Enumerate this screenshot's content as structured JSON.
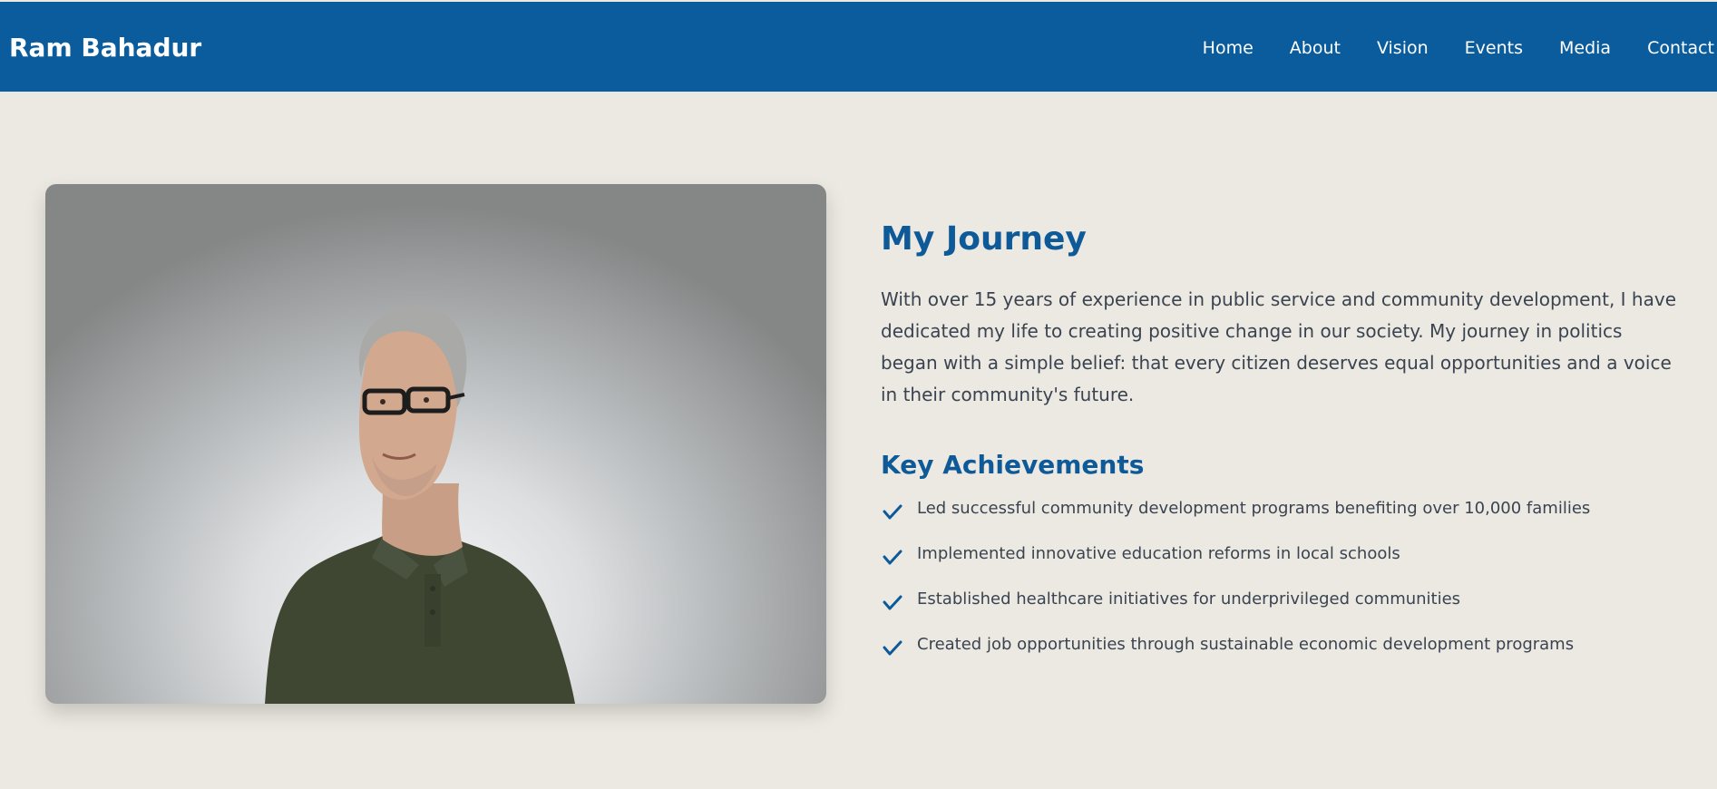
{
  "header": {
    "brand": "Ram Bahadur",
    "nav": [
      "Home",
      "About",
      "Vision",
      "Events",
      "Media",
      "Contact"
    ]
  },
  "journey": {
    "title": "My Journey",
    "intro": "With over 15 years of experience in public service and community development, I have dedicated my life to creating positive change in our society. My journey in politics began with a simple belief: that every citizen deserves equal opportunities and a voice in their community's future."
  },
  "achievements": {
    "title": "Key Achievements",
    "items": [
      "Led successful community development programs benefiting over 10,000 families",
      "Implemented innovative education reforms in local schools",
      "Established healthcare initiatives for underprivileged communities",
      "Created job opportunities through sustainable economic development programs"
    ],
    "icon": "check-icon"
  },
  "colors": {
    "header_bg": "#0b5c9c",
    "accent": "#0e5a99",
    "page_bg": "#ece9e2",
    "body_text": "#3a4350"
  }
}
